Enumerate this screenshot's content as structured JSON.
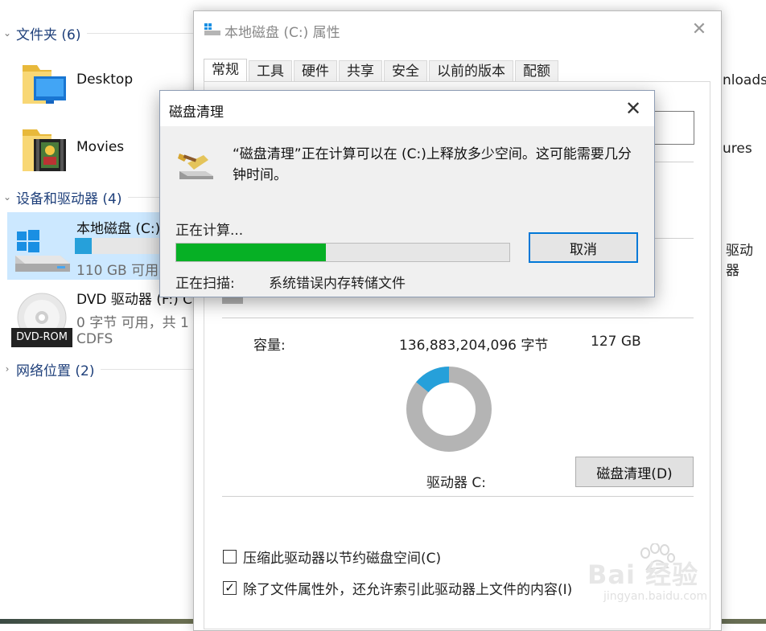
{
  "explorer": {
    "groups": [
      {
        "label": "文件夹 (6)"
      },
      {
        "label": "设备和驱动器 (4)"
      },
      {
        "label": "网络位置 (2)"
      }
    ],
    "folders": [
      {
        "name": "Desktop"
      },
      {
        "name": "Movies"
      }
    ],
    "right_partial": [
      "nloads",
      "ures",
      "驱动器"
    ],
    "drives": [
      {
        "name": "本地磁盘 (C:)",
        "free": "110 GB 可用",
        "usage_fraction": 0.14
      },
      {
        "name": "DVD 驱动器 (F:) C",
        "free": "0 字节 可用，共 1",
        "fs": "CDFS",
        "badge": "DVD-ROM"
      }
    ]
  },
  "properties": {
    "title": "本地磁盘 (C:) 属性",
    "tabs": [
      "常规",
      "工具",
      "硬件",
      "共享",
      "安全",
      "以前的版本",
      "配额"
    ],
    "capacity_label": "容量:",
    "capacity_bytes": "136,883,204,096 字节",
    "capacity_gb": "127 GB",
    "drive_label": "驱动器 C:",
    "cleanup_button": "磁盘清理(D)",
    "used_fraction": 0.14,
    "checkboxes": [
      {
        "label": "压缩此驱动器以节约磁盘空间(C)",
        "checked": false
      },
      {
        "label": "除了文件属性外，还允许索引此驱动器上文件的内容(I)",
        "checked": true
      }
    ]
  },
  "dialog": {
    "title": "磁盘清理",
    "message": "“磁盘清理”正在计算可以在 (C:)上释放多少空间。这可能需要几分钟时间。",
    "status": "正在计算...",
    "progress_fraction": 0.45,
    "cancel_label": "取消",
    "scan_label": "正在扫描:",
    "scan_item": "系统错误内存转储文件"
  },
  "watermark": {
    "text": "Bai 经验",
    "url": "jingyan.baidu.com"
  },
  "colors": {
    "progress_green": "#06b025",
    "drive_bar_blue": "#26a0da",
    "donut_used": "#26a0da",
    "donut_free": "#b4b4b4",
    "selection": "#cce8ff",
    "accent": "#0078d7"
  }
}
